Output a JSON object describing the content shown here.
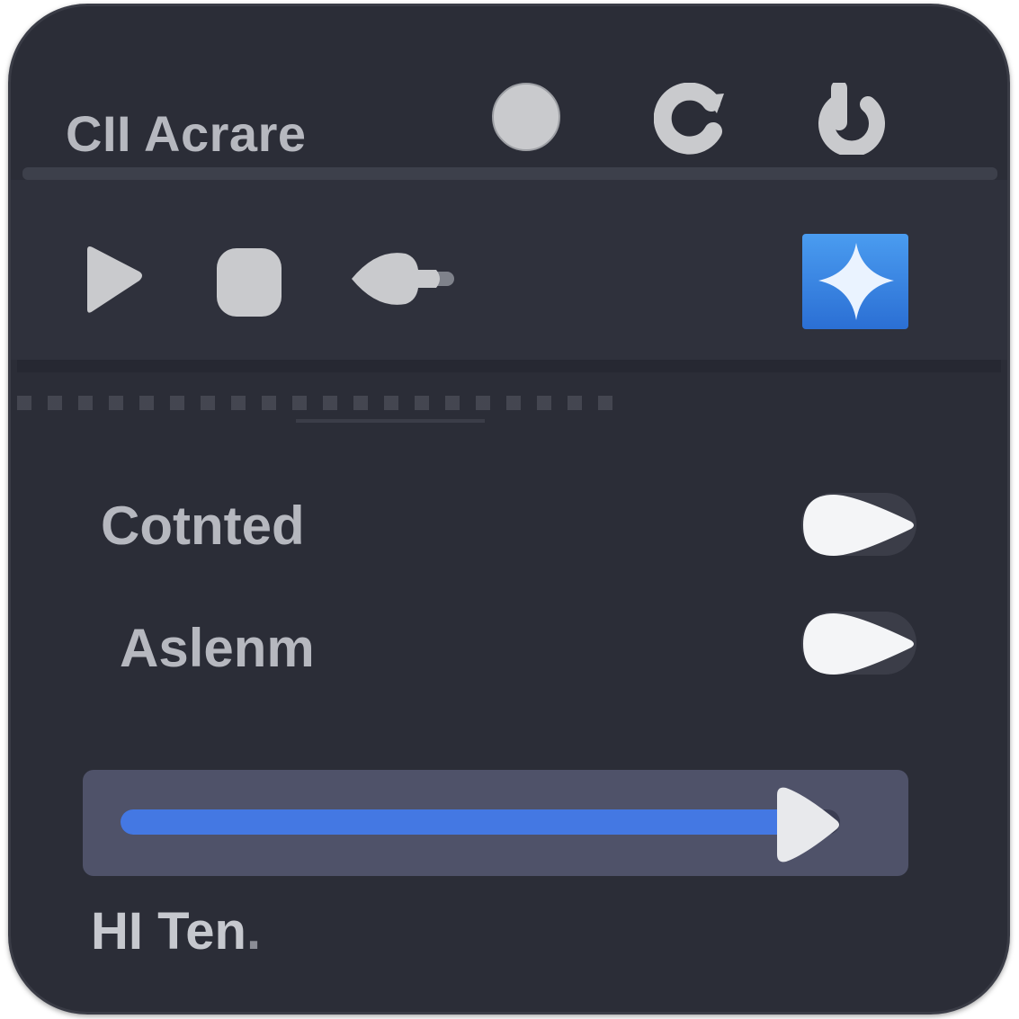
{
  "window": {
    "title": "CII Acrare"
  },
  "titlebar_icons": [
    "circle-icon",
    "refresh-icon",
    "power-icon"
  ],
  "toolbar": {
    "items": [
      "play-icon",
      "stop-icon",
      "back-icon"
    ],
    "accent_button": "sparkle-icon",
    "accent_color": "#3b86e0"
  },
  "settings": {
    "rows": [
      {
        "label": "Cotnted",
        "toggle": "on"
      },
      {
        "label": "Aslenm",
        "toggle": "on"
      }
    ]
  },
  "slider": {
    "value_fraction": 0.94,
    "fill_color": "#4478e3"
  },
  "footer": {
    "label": "HI Ten"
  }
}
